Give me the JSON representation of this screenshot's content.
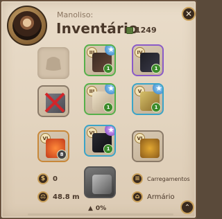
{
  "header": {
    "player_name": "Manoliso:",
    "title": "Inventário",
    "weight_value": "1249",
    "close_icon": "close-icon"
  },
  "slots": [
    {
      "name": "slot-empty-bag",
      "tier": "",
      "enchant": ""
    },
    {
      "name": "slot-cape",
      "tier": "III",
      "enchant": "1"
    },
    {
      "name": "slot-head",
      "tier": "IV",
      "enchant": "1"
    },
    {
      "name": "slot-broken",
      "tier": "",
      "enchant": ""
    },
    {
      "name": "slot-armor",
      "tier": "III",
      "enchant": "1"
    },
    {
      "name": "slot-offhand",
      "tier": "V",
      "enchant": "1"
    },
    {
      "name": "slot-potion",
      "tier": "VI",
      "enchant": "8"
    },
    {
      "name": "slot-boots",
      "tier": "VI",
      "enchant": "1"
    },
    {
      "name": "slot-food",
      "tier": "VI",
      "enchant": ""
    },
    {
      "name": "slot-mount",
      "tier": "",
      "enchant": ""
    }
  ],
  "stats": {
    "silver": "0",
    "weight": "48.8 m"
  },
  "buttons": {
    "loadouts": "Carregamentos",
    "wardrobe": "Armário"
  },
  "footer": {
    "load_percent": "0%",
    "load_fraction": 0
  }
}
